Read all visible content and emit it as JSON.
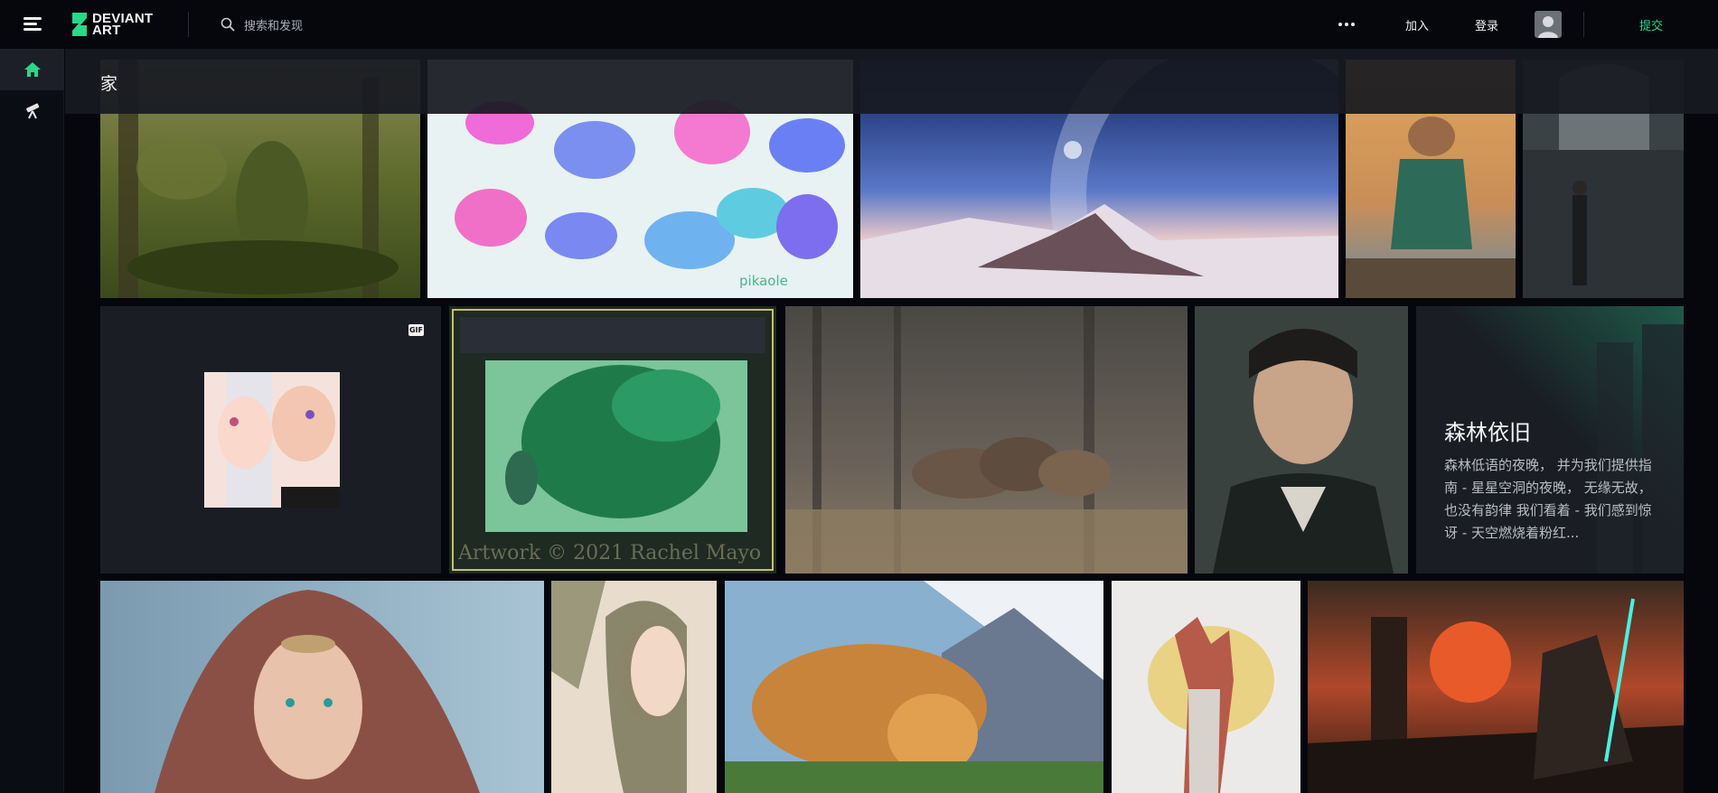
{
  "header": {
    "logo_text_line1": "DEVIANT",
    "logo_text_line2": "ART",
    "search_placeholder": "搜索和发现",
    "join_label": "加入",
    "login_label": "登录",
    "submit_label": "提交"
  },
  "sidebar": {
    "items": [
      {
        "name": "home",
        "icon": "home-icon"
      },
      {
        "name": "watch",
        "icon": "telescope-icon"
      }
    ]
  },
  "page": {
    "title": "家"
  },
  "gallery": {
    "gif_badge": "GIF",
    "literature_card": {
      "title": "森林依旧",
      "excerpt": "森林低语的夜晚， 并为我们提供指南 - 星星空洞的夜晚， 无缘无故，也没有韵律 我们看着 - 我们感到惊讶 - 天空燃烧着粉红..."
    },
    "watermarks": {
      "pikaole": "pikaole",
      "dragon": "Artwork © 2021 Rachel Mayo"
    }
  },
  "colors": {
    "accent": "#2bd689",
    "background": "#06070d",
    "sidebar": "#0b0d14",
    "card": "#1a1d24"
  }
}
